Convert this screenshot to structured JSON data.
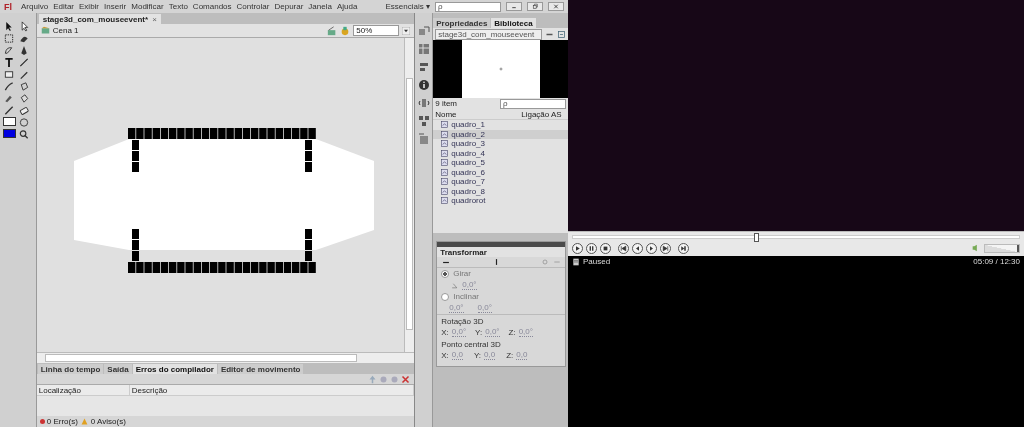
{
  "app": {
    "logo": "Fl",
    "menu": [
      "Arquivo",
      "Editar",
      "Exibir",
      "Inserir",
      "Modificar",
      "Texto",
      "Comandos",
      "Controlar",
      "Depurar",
      "Janela",
      "Ajuda"
    ],
    "workspace": "Essenciais",
    "workspace_caret": "▾",
    "search": {
      "placeholder": "ρ"
    }
  },
  "document": {
    "tab": "stage3d_com_mouseevent*",
    "tab_close": "×",
    "scene": "Cena 1",
    "zoom": "50%"
  },
  "library": {
    "tabs": [
      {
        "label": "Propriedades",
        "selected": false
      },
      {
        "label": "Biblioteca",
        "selected": true
      }
    ],
    "file": "stage3d_com_mouseevent",
    "count": "9 item",
    "search": {
      "placeholder": "ρ"
    },
    "columns": [
      "Nome",
      "Ligação AS"
    ],
    "items": [
      {
        "name": "quadro_1",
        "selected": false
      },
      {
        "name": "quadro_2",
        "selected": true
      },
      {
        "name": "quadro_3",
        "selected": false
      },
      {
        "name": "quadro_4",
        "selected": false
      },
      {
        "name": "quadro_5",
        "selected": false
      },
      {
        "name": "quadro_6",
        "selected": false
      },
      {
        "name": "quadro_7",
        "selected": false
      },
      {
        "name": "quadro_8",
        "selected": false
      },
      {
        "name": "quadrorot",
        "selected": false
      }
    ]
  },
  "transform": {
    "title": "Transformar",
    "rotate": {
      "label": "Girar",
      "value": "0,0°",
      "selected": true
    },
    "skew": {
      "label": "Inclinar",
      "value_1": "0,0°",
      "value_2": "0,0°",
      "selected": false
    },
    "rotation3d": {
      "label": "Rotação 3D",
      "fields": [
        {
          "axis": "X:",
          "value": "0,0°"
        },
        {
          "axis": "Y:",
          "value": "0,0°"
        },
        {
          "axis": "Z:",
          "value": "0,0°"
        }
      ]
    },
    "center3d": {
      "label": "Ponto central 3D",
      "fields": [
        {
          "axis": "X:",
          "value": "0,0"
        },
        {
          "axis": "Y:",
          "value": "0,0"
        },
        {
          "axis": "Z:",
          "value": "0,0"
        }
      ]
    }
  },
  "output": {
    "tabs": [
      {
        "label": "Linha do tempo",
        "selected": false
      },
      {
        "label": "Saída",
        "selected": false
      },
      {
        "label": "Erros do compilador",
        "selected": true
      },
      {
        "label": "Editor de movimento",
        "selected": false
      }
    ],
    "columns": [
      "Localização",
      "Descrição"
    ],
    "errors": "0 Erro(s)",
    "warnings": "0 Aviso(s)"
  },
  "player": {
    "seek": {
      "level": 0.41
    },
    "volume": {
      "level": 0.95
    },
    "status": "Paused",
    "time": "05:09 / 12:30"
  }
}
